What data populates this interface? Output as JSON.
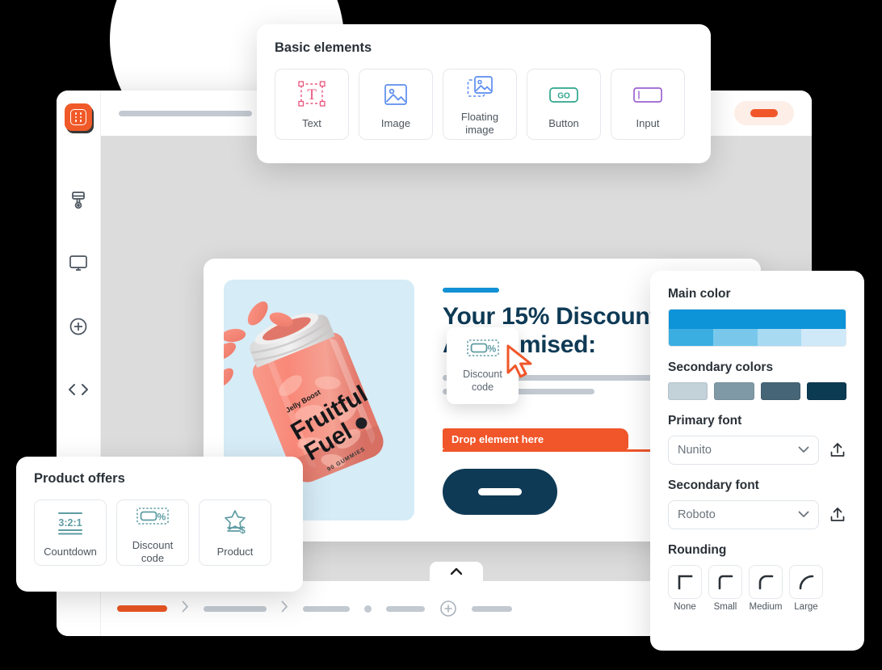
{
  "app": {
    "logo_icon": "grid-logo-icon",
    "sidebar_items": [
      {
        "name": "brush",
        "icon": "paint-brush-icon"
      },
      {
        "name": "preview",
        "icon": "monitor-icon"
      },
      {
        "name": "add",
        "icon": "plus-circle-icon"
      },
      {
        "name": "code",
        "icon": "code-brackets-icon"
      }
    ]
  },
  "topbar": {
    "action_icon": "orange-pill-button"
  },
  "popup": {
    "accent": "#1391d5",
    "close_icon": "close-icon",
    "headline_line1": "Your 15% Discount",
    "headline_line2": "As Promised:",
    "drop_label": "Drop element here",
    "cta_icon": "cta-button-placeholder",
    "product": {
      "brand": "Jelly Boost",
      "name_line1": "Fruitful",
      "name_line2": "Fuel",
      "count": "90 GUMMIES",
      "bg_color": "#d6ecf7"
    }
  },
  "drag_card": {
    "icon": "discount-code-icon",
    "label_line1": "Discount",
    "label_line2": "code",
    "cursor_icon": "drag-cursor-icon"
  },
  "basic_elements": {
    "title": "Basic elements",
    "tiles": [
      {
        "label": "Text",
        "icon": "text-box-icon",
        "color": "#e8567f"
      },
      {
        "label": "Image",
        "icon": "image-icon",
        "color": "#5b8def"
      },
      {
        "label_line1": "Floating",
        "label_line2": "image",
        "icon": "floating-image-icon",
        "color": "#5b8def"
      },
      {
        "label": "Button",
        "icon": "go-button-icon",
        "color": "#2ea58c",
        "glyph": "GO"
      },
      {
        "label": "Input",
        "icon": "input-field-icon",
        "color": "#9b63d3"
      }
    ]
  },
  "product_offers": {
    "title": "Product offers",
    "tiles": [
      {
        "label": "Countdown",
        "icon": "countdown-icon",
        "glyph": "3:2:1",
        "color": "#5f9ca3"
      },
      {
        "label_line1": "Discount",
        "label_line2": "code",
        "icon": "discount-code-icon",
        "color": "#5f9ca3"
      },
      {
        "label": "Product",
        "icon": "product-star-icon",
        "color": "#5f9ca3"
      }
    ]
  },
  "design_panel": {
    "main_color_label": "Main color",
    "main_color_top": "#0d93d8",
    "main_color_tints": [
      "#3aaee0",
      "#79c8ec",
      "#a8daf2",
      "#cfe9f8"
    ],
    "secondary_colors_label": "Secondary colors",
    "secondary_colors": [
      "#c3d1d9",
      "#8099a6",
      "#466577",
      "#0b3a53"
    ],
    "primary_font_label": "Primary font",
    "primary_font_value": "Nunito",
    "secondary_font_label": "Secondary font",
    "secondary_font_value": "Roboto",
    "upload_icon": "upload-icon",
    "chevron_icon": "chevron-down-icon",
    "rounding_label": "Rounding",
    "rounding_options": [
      {
        "label": "None",
        "icon": "corner-none-icon"
      },
      {
        "label": "Small",
        "icon": "corner-small-icon"
      },
      {
        "label": "Medium",
        "icon": "corner-medium-icon"
      },
      {
        "label": "Large",
        "icon": "corner-large-icon"
      }
    ]
  },
  "bottombar": {
    "collapse_icon": "chevron-up-icon",
    "separator_icon": "chevron-right-icon",
    "add_icon": "plus-circle-icon"
  }
}
